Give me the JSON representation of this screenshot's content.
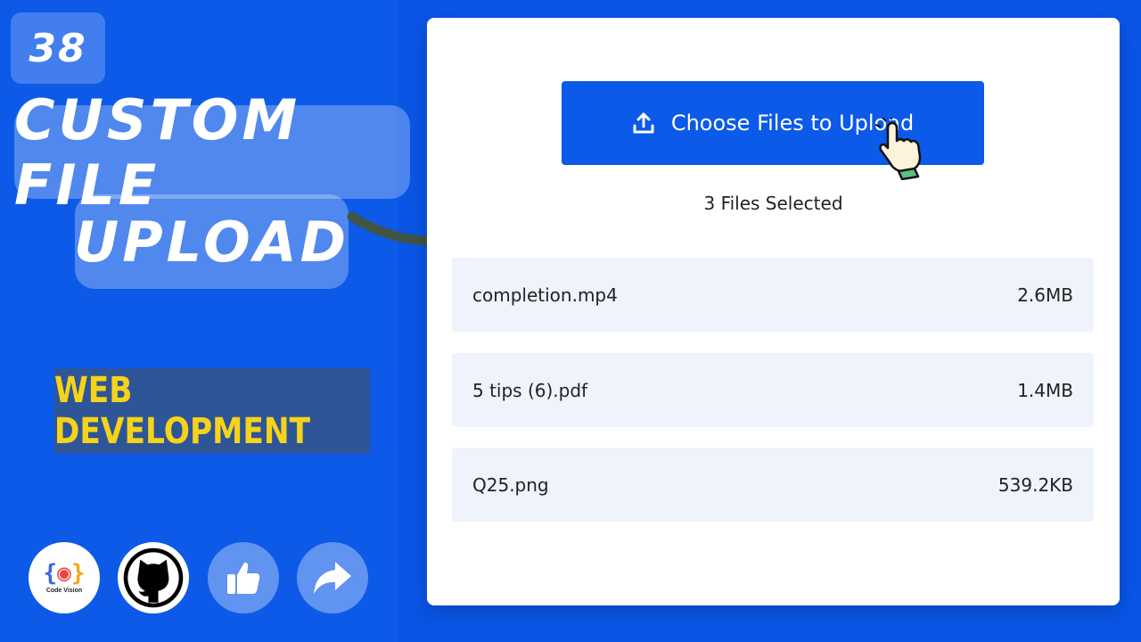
{
  "thumbnail": {
    "episode": "38",
    "title_line1": "CUSTOM FILE",
    "title_line2": "UPLOAD",
    "category": "WEB DEVELOPMENT",
    "social": {
      "code_vision_label": "Code Vision",
      "icons": [
        "code-vision-logo-icon",
        "github-icon",
        "thumbs-up-icon",
        "share-icon"
      ]
    }
  },
  "uploader": {
    "button_label": "Choose Files to Upload",
    "files_selected": "3 Files Selected",
    "files": [
      {
        "name": "completion.mp4",
        "size": "2.6MB"
      },
      {
        "name": "5 tips (6).pdf",
        "size": "1.4MB"
      },
      {
        "name": "Q25.png",
        "size": "539.2KB"
      }
    ]
  },
  "colors": {
    "background": "#0d5ae8",
    "button": "#0b5ae9",
    "row_bg": "#eef3fc",
    "category_text": "#f6d21a",
    "category_bg": "#2d5597",
    "arrow": "#3f5548"
  }
}
